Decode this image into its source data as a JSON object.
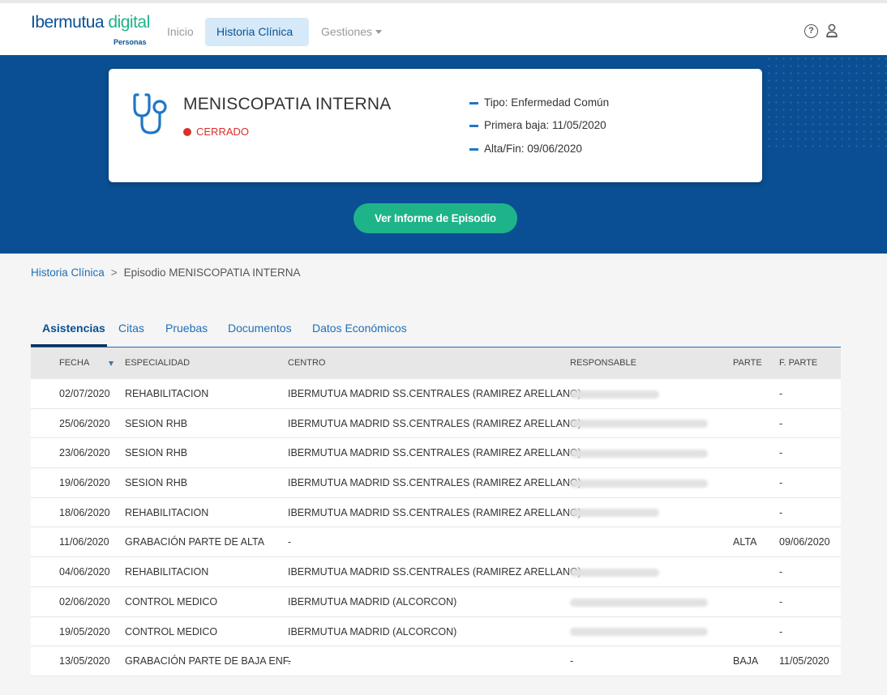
{
  "nav": {
    "logo_main": "Ibermutua",
    "logo_accent": "digital",
    "logo_sub": "Personas",
    "inicio": "Inicio",
    "historia": "Historia Clínica",
    "gestiones": "Gestiones"
  },
  "episode": {
    "title": "MENISCOPATIA INTERNA",
    "status": "CERRADO",
    "tipo": "Tipo: Enfermedad Común",
    "primera_baja": "Primera baja: 11/05/2020",
    "alta": "Alta/Fin: 09/06/2020",
    "report_button": "Ver Informe de Episodio"
  },
  "breadcrumb": {
    "root": "Historia Clínica",
    "separator": ">",
    "current": "Episodio MENISCOPATIA INTERNA"
  },
  "tabs": [
    "Asistencias",
    "Citas",
    "Pruebas",
    "Documentos",
    "Datos Económicos"
  ],
  "table": {
    "headers": {
      "fecha": "FECHA",
      "especialidad": "ESPECIALIDAD",
      "centro": "CENTRO",
      "responsable": "RESPONSABLE",
      "parte": "PARTE",
      "f_parte": "F. PARTE"
    },
    "rows": [
      {
        "fecha": "02/07/2020",
        "especialidad": "REHABILITACION",
        "centro": "IBERMUTUA MADRID SS.CENTRALES (RAMIREZ ARELLANO)",
        "parte": "",
        "f_parte": "-"
      },
      {
        "fecha": "25/06/2020",
        "especialidad": "SESION RHB",
        "centro": "IBERMUTUA MADRID SS.CENTRALES (RAMIREZ ARELLANO)",
        "parte": "",
        "f_parte": "-"
      },
      {
        "fecha": "23/06/2020",
        "especialidad": "SESION RHB",
        "centro": "IBERMUTUA MADRID SS.CENTRALES (RAMIREZ ARELLANO)",
        "parte": "",
        "f_parte": "-"
      },
      {
        "fecha": "19/06/2020",
        "especialidad": "SESION RHB",
        "centro": "IBERMUTUA MADRID SS.CENTRALES (RAMIREZ ARELLANO)",
        "parte": "",
        "f_parte": "-"
      },
      {
        "fecha": "18/06/2020",
        "especialidad": "REHABILITACION",
        "centro": "IBERMUTUA MADRID SS.CENTRALES (RAMIREZ ARELLANO)",
        "parte": "",
        "f_parte": "-"
      },
      {
        "fecha": "11/06/2020",
        "especialidad": "GRABACIÓN PARTE DE ALTA",
        "centro": "-",
        "parte": "ALTA",
        "f_parte": "09/06/2020"
      },
      {
        "fecha": "04/06/2020",
        "especialidad": "REHABILITACION",
        "centro": "IBERMUTUA MADRID SS.CENTRALES (RAMIREZ ARELLANO)",
        "parte": "",
        "f_parte": "-"
      },
      {
        "fecha": "02/06/2020",
        "especialidad": "CONTROL MEDICO",
        "centro": "IBERMUTUA MADRID (ALCORCON)",
        "parte": "",
        "f_parte": "-"
      },
      {
        "fecha": "19/05/2020",
        "especialidad": "CONTROL MEDICO",
        "centro": "IBERMUTUA MADRID (ALCORCON)",
        "parte": "",
        "f_parte": "-"
      },
      {
        "fecha": "13/05/2020",
        "especialidad": "GRABACIÓN PARTE DE BAJA ENF.",
        "centro": "-",
        "responsable": "-",
        "parte": "BAJA",
        "f_parte": "11/05/2020"
      }
    ]
  },
  "colors": {
    "brand_blue": "#0a4f93",
    "accent_green": "#1fb38a",
    "status_red": "#d9302c",
    "link_blue": "#1f6fb6"
  }
}
